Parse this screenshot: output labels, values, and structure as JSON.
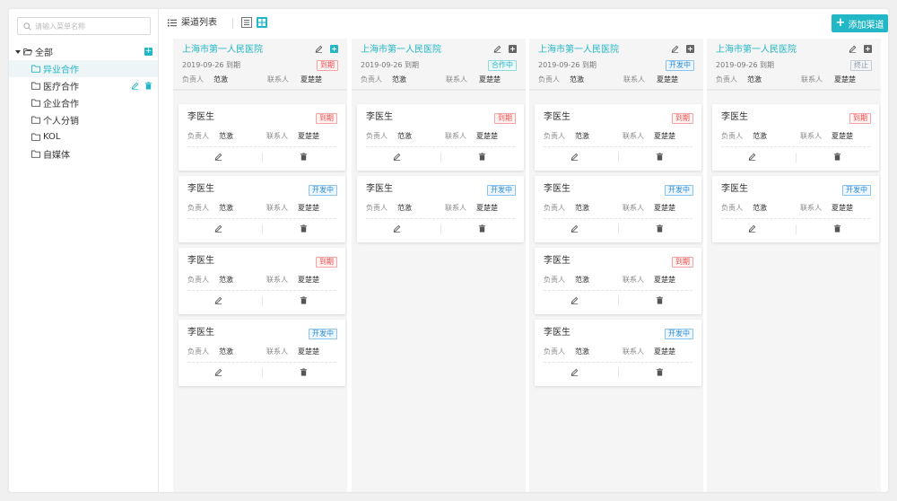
{
  "sidebar": {
    "search_placeholder": "请输入菜单名称",
    "root": {
      "label": "全部"
    },
    "items": [
      {
        "label": "异业合作",
        "selected": true
      },
      {
        "label": "医疗合作",
        "selected": false
      },
      {
        "label": "企业合作",
        "selected": false
      },
      {
        "label": "个人分销",
        "selected": false
      },
      {
        "label": "KOL",
        "selected": false
      },
      {
        "label": "自媒体",
        "selected": false
      }
    ]
  },
  "toolbar": {
    "title": "渠道列表",
    "add_button": "添加渠道"
  },
  "labels": {
    "owner": "负责人",
    "contact": "联系人"
  },
  "colors": {
    "accent": "#22b7c6",
    "expired": "#f04d4d",
    "developing": "#2a8bd6",
    "stopped": "#8a95a5"
  },
  "columns": [
    {
      "title": "上海市第一人民医院",
      "date": "2019-09-26 到期",
      "status": "到期",
      "status_type": "expired",
      "owner": "范激",
      "contact": "夏楚楚",
      "cards": [
        {
          "name": "李医生",
          "status": "到期",
          "status_type": "expired",
          "owner": "范激",
          "contact": "夏楚楚"
        },
        {
          "name": "李医生",
          "status": "开发中",
          "status_type": "dev",
          "owner": "范激",
          "contact": "夏楚楚"
        },
        {
          "name": "李医生",
          "status": "到期",
          "status_type": "expired",
          "owner": "范激",
          "contact": "夏楚楚"
        },
        {
          "name": "李医生",
          "status": "开发中",
          "status_type": "dev",
          "owner": "范激",
          "contact": "夏楚楚"
        }
      ]
    },
    {
      "title": "上海市第一人民医院",
      "date": "2019-09-26 到期",
      "status": "合作中",
      "status_type": "coop",
      "owner": "范激",
      "contact": "夏楚楚",
      "cards": [
        {
          "name": "李医生",
          "status": "到期",
          "status_type": "expired",
          "owner": "范激",
          "contact": "夏楚楚"
        },
        {
          "name": "李医生",
          "status": "开发中",
          "status_type": "dev",
          "owner": "范激",
          "contact": "夏楚楚"
        }
      ]
    },
    {
      "title": "上海市第一人民医院",
      "date": "2019-09-26 到期",
      "status": "开发中",
      "status_type": "dev",
      "owner": "范激",
      "contact": "夏楚楚",
      "cards": [
        {
          "name": "李医生",
          "status": "到期",
          "status_type": "expired",
          "owner": "范激",
          "contact": "夏楚楚"
        },
        {
          "name": "李医生",
          "status": "开发中",
          "status_type": "dev",
          "owner": "范激",
          "contact": "夏楚楚"
        },
        {
          "name": "李医生",
          "status": "到期",
          "status_type": "expired",
          "owner": "范激",
          "contact": "夏楚楚"
        },
        {
          "name": "李医生",
          "status": "开发中",
          "status_type": "dev",
          "owner": "范激",
          "contact": "夏楚楚"
        }
      ]
    },
    {
      "title": "上海市第一人民医院",
      "date": "2019-09-26 到期",
      "status": "终止",
      "status_type": "stop",
      "owner": "范激",
      "contact": "夏楚楚",
      "cards": [
        {
          "name": "李医生",
          "status": "到期",
          "status_type": "expired",
          "owner": "范激",
          "contact": "夏楚楚"
        },
        {
          "name": "李医生",
          "status": "开发中",
          "status_type": "dev",
          "owner": "范激",
          "contact": "夏楚楚"
        }
      ]
    }
  ]
}
